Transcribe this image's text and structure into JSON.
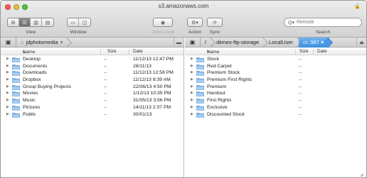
{
  "window": {
    "title": "s3.amazonaws.com"
  },
  "toolbar": {
    "view_label": "View",
    "window_label": "Window",
    "quicklook_label": "Quick Look",
    "action_label": "Action",
    "sync_label": "Sync",
    "search_label": "Search",
    "search_placeholder": "Remote"
  },
  "left_pane": {
    "path": {
      "crumb": "jdphotomedia"
    },
    "columns": {
      "name": "Name",
      "size": "Size",
      "date": "Date"
    },
    "rows": [
      {
        "name": "Desktop",
        "size": "--",
        "date": "11/12/13 12:47 PM"
      },
      {
        "name": "Documents",
        "size": "--",
        "date": "28/11/13"
      },
      {
        "name": "Downloads",
        "size": "--",
        "date": "11/12/13 12:58 PM"
      },
      {
        "name": "Dropbox",
        "size": "--",
        "date": "11/12/13 8:39 AM"
      },
      {
        "name": "Group Buying Projects",
        "size": "--",
        "date": "22/06/13 4:50 PM"
      },
      {
        "name": "Movies",
        "size": "--",
        "date": "1/12/13 10:35 PM"
      },
      {
        "name": "Music",
        "size": "--",
        "date": "31/05/13 3:56 PM"
      },
      {
        "name": "Pictures",
        "size": "--",
        "date": "14/11/13 2:37 PM"
      },
      {
        "name": "Public",
        "size": "--",
        "date": "30/01/13"
      }
    ]
  },
  "right_pane": {
    "path": {
      "root": "/",
      "crumbs": [
        "diimex-ftp-storage",
        "LocalUser",
        "387"
      ]
    },
    "columns": {
      "name": "Name",
      "size": "Size",
      "date": "Date"
    },
    "rows": [
      {
        "name": "Stock",
        "size": "--"
      },
      {
        "name": "Red Carpet",
        "size": "--"
      },
      {
        "name": "Premium Stock",
        "size": "--"
      },
      {
        "name": "Premium First Rights",
        "size": "--"
      },
      {
        "name": "Premium",
        "size": "--"
      },
      {
        "name": "Handout",
        "size": "--"
      },
      {
        "name": "First Rights",
        "size": "--"
      },
      {
        "name": "Exclusive",
        "size": "--"
      },
      {
        "name": "Discounted Stock",
        "size": "--"
      }
    ]
  },
  "colors": {
    "folder": "#7fb6e8",
    "active_crumb": "#4a97e6"
  }
}
